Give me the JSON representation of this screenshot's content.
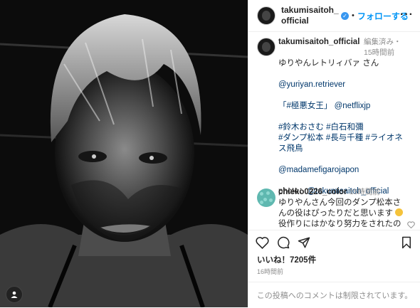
{
  "header": {
    "username": "takumisaitoh_official",
    "separator": "•",
    "follow_label": "フォローする",
    "more_label": "···"
  },
  "caption": {
    "username": "takumisaitoh_official",
    "edited": "編集済み",
    "dot": "・",
    "time": "15時間前",
    "line1": "ゆりやんレトリィバァ さん",
    "line2": "@yuriyan.retriever",
    "line3a": "「#極悪女王」",
    "line3b": "@netflixjp",
    "line4": "#鈴木おさむ #白石和彌",
    "line5": "#ダンプ松本 #長与千種 #ライオネス飛鳥",
    "line6": "@madamefigarojapon",
    "line7a": "photo：",
    "line7b": "@takumisaitoh_official"
  },
  "comment": {
    "username": "chieko0226_color",
    "time": "15時間前",
    "text1": "ゆりやんさん今回のダンプ松本さんの役はぴったりだと思います",
    "text2": "役作りにはかなり努力をされたの"
  },
  "likes": {
    "label": "いいね！",
    "count": "7205件"
  },
  "post_time": "16時間前",
  "comments_disabled": "この投稿へのコメントは制限されています。",
  "icons": [
    "user-tag-icon",
    "verified-badge-icon",
    "heart-icon",
    "comment-icon",
    "share-icon",
    "save-icon"
  ],
  "colors": {
    "follow": "#0095f6",
    "verified": "#3897f0",
    "link": "#00376b",
    "muted": "#8e8e8e"
  }
}
